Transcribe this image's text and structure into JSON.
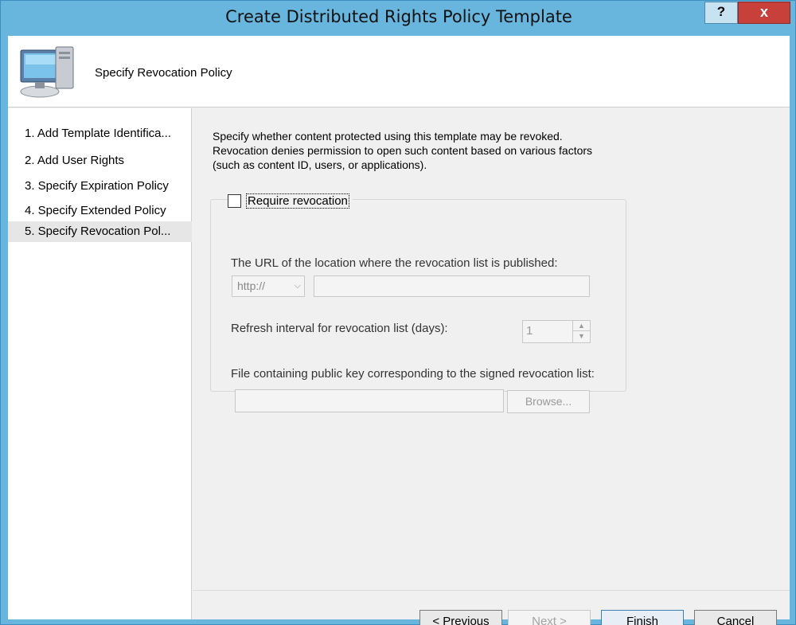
{
  "window": {
    "title": "Create Distributed Rights Policy Template",
    "help_label": "?",
    "close_label": "x"
  },
  "header": {
    "title": "Specify Revocation Policy",
    "icon": "computer-icon"
  },
  "steps": [
    {
      "label": "1. Add Template Identifica..."
    },
    {
      "label": "2. Add User Rights"
    },
    {
      "label": "3. Specify Expiration Policy"
    },
    {
      "label": "4. Specify Extended Policy"
    },
    {
      "label": "5. Specify Revocation Pol...",
      "active": true
    }
  ],
  "content": {
    "description": "Specify whether content protected using this template may be revoked. Revocation denies permission to open such content based on various factors (such as content ID, users, or applications).",
    "require_revocation": {
      "label": "Require revocation",
      "checked": false
    },
    "url_label": "The URL of the location where the revocation list is published:",
    "protocol_selected": "http://",
    "url_value": "",
    "refresh_label": "Refresh interval for revocation list (days):",
    "refresh_value": "1",
    "public_key_label": "File containing public key corresponding to the signed revocation list:",
    "public_key_value": "",
    "browse_label": "Browse..."
  },
  "buttons": {
    "previous": "< Previous",
    "next": "Next >",
    "finish": "Finish",
    "cancel": "Cancel"
  }
}
